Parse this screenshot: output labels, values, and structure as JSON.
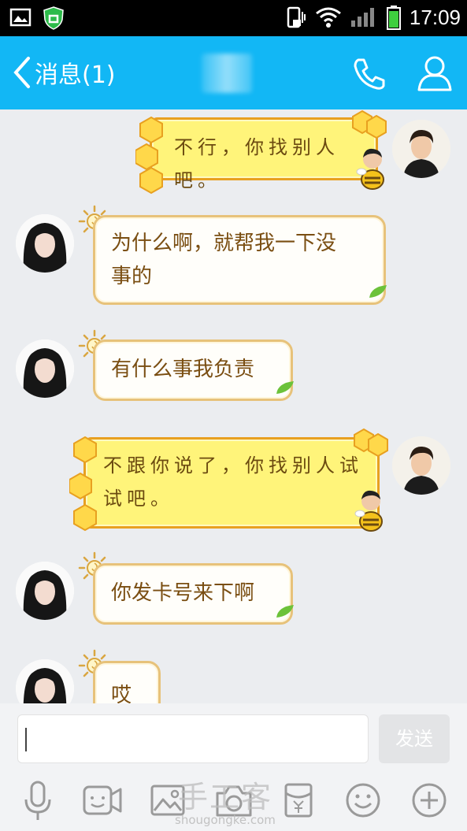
{
  "status_bar": {
    "time": "17:09",
    "icons": [
      "image-icon",
      "shield-app-icon",
      "phone-vibrate-icon",
      "wifi-icon",
      "signal-icon",
      "battery-icon"
    ]
  },
  "nav": {
    "back_label": "消息(1)",
    "icons": [
      "chevron-left-icon",
      "phone-icon",
      "profile-icon"
    ],
    "accent_color": "#12b7f5"
  },
  "messages": [
    {
      "side": "right",
      "style": "honey",
      "text": "不行，你找别人吧。"
    },
    {
      "side": "left",
      "style": "sun",
      "text_lines": [
        "为什么啊，就帮我一下没",
        "事的"
      ]
    },
    {
      "side": "left",
      "style": "sun",
      "text": "有什么事我负责"
    },
    {
      "side": "right",
      "style": "honey",
      "text_lines": [
        "不跟你说了，你找别人试",
        "试吧。"
      ]
    },
    {
      "side": "left",
      "style": "sun",
      "text": "你发卡号来下啊"
    },
    {
      "side": "left",
      "style": "sun",
      "text": "哎"
    }
  ],
  "input": {
    "value": "",
    "send_label": "发送"
  },
  "toolbar": {
    "icons": [
      "microphone-icon",
      "video-icon",
      "image-icon",
      "camera-icon",
      "red-packet-icon",
      "emoji-icon",
      "plus-icon"
    ]
  },
  "watermark": {
    "text": "手工客",
    "url": "shougongke.com"
  }
}
